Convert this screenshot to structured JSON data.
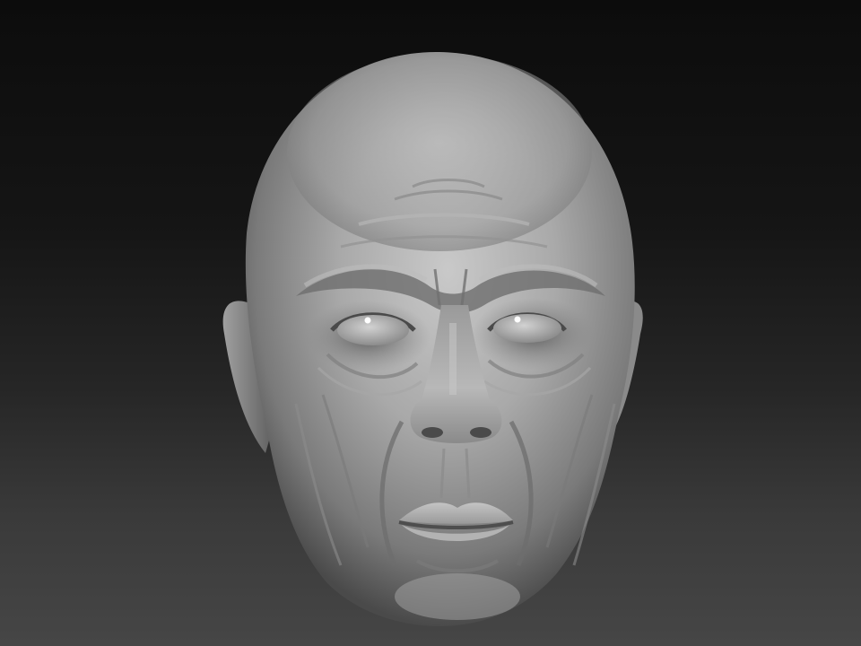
{
  "viewport": {
    "background_top": "#0c0c0c",
    "background_bottom": "#464646"
  },
  "model": {
    "material_color": "#9a9a9a",
    "highlight_color": "#c8c8c8",
    "shadow_color": "#3c3c3c"
  }
}
